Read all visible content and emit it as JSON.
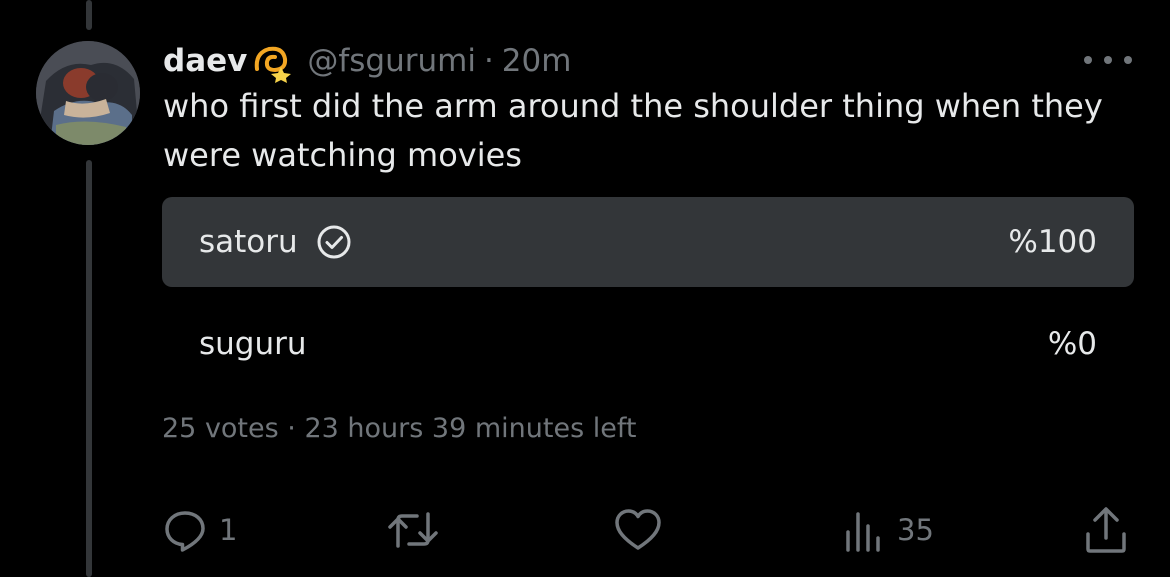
{
  "colors": {
    "background": "#000000",
    "text_primary": "#e7e9ea",
    "text_secondary": "#71767b",
    "poll_winner_bg": "#333639",
    "thread_line": "#333639"
  },
  "tweet": {
    "author": {
      "display_name": "daev",
      "name_emoji": "dizzy-emoji",
      "handle": "@fsgurumi",
      "separator": "·",
      "time": "20m",
      "avatar_icon": "avatar-image"
    },
    "text": "who first did the arm around the shoulder thing when they were watching movies",
    "poll": {
      "options": [
        {
          "label": "satoru",
          "percent": "%100",
          "selected": true,
          "selected_icon": "check-circle-icon"
        },
        {
          "label": "suguru",
          "percent": "%0",
          "selected": false
        }
      ],
      "votes": "25 votes",
      "separator": "·",
      "time_left": "23 hours 39 minutes left"
    },
    "actions": {
      "reply": {
        "icon": "reply-icon",
        "count": "1"
      },
      "retweet": {
        "icon": "retweet-icon",
        "count": ""
      },
      "like": {
        "icon": "heart-icon",
        "count": ""
      },
      "views": {
        "icon": "views-icon",
        "count": "35"
      },
      "share": {
        "icon": "share-icon"
      }
    },
    "more_icon": "more-dots-icon"
  }
}
